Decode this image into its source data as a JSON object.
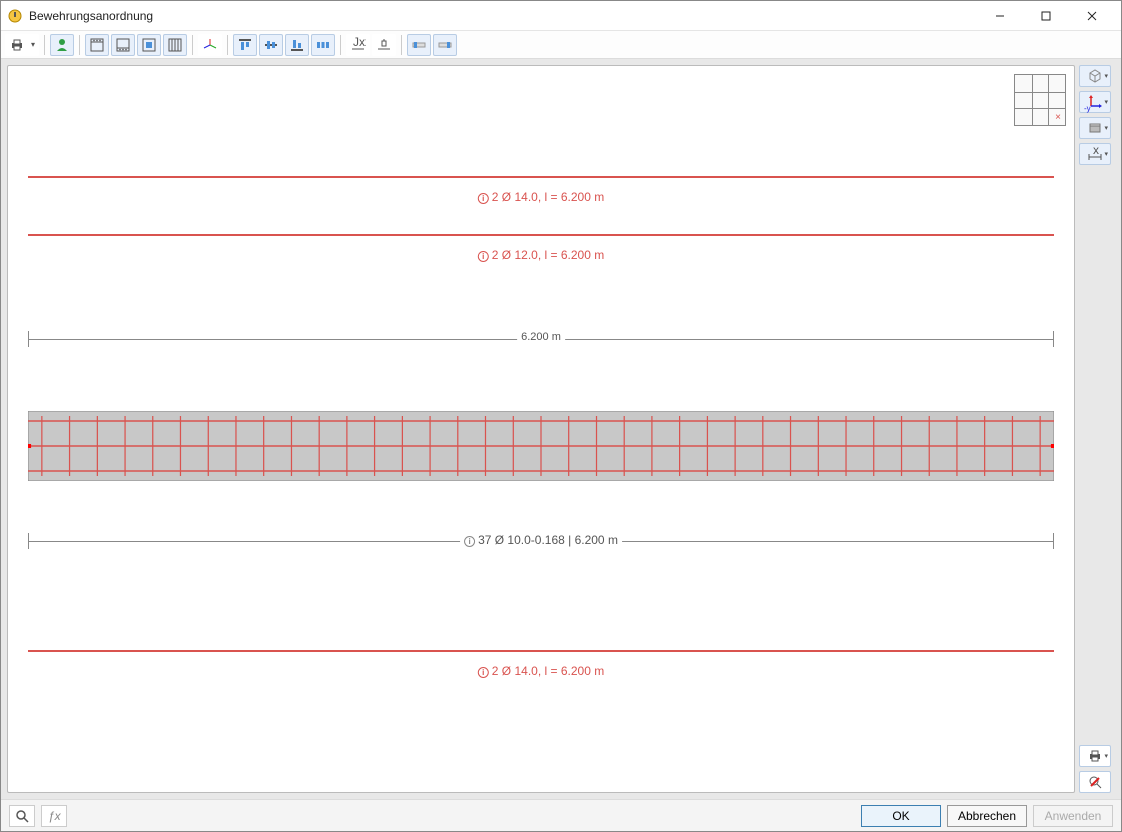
{
  "window": {
    "title": "Bewehrungsanordnung"
  },
  "rebars": {
    "top1": "2 Ø 14.0, l =  6.200 m",
    "top2": "2 Ø 12.0, l =  6.200 m",
    "length_dim": "6.200 m",
    "stirrups": "37 Ø 10.0-0.168 | 6.200 m",
    "bottom1": "2 Ø 14.0, l =  6.200 m"
  },
  "right_sidebar": {
    "axis_label": "-y"
  },
  "buttons": {
    "ok": "OK",
    "cancel": "Abbrechen",
    "apply": "Anwenden"
  }
}
